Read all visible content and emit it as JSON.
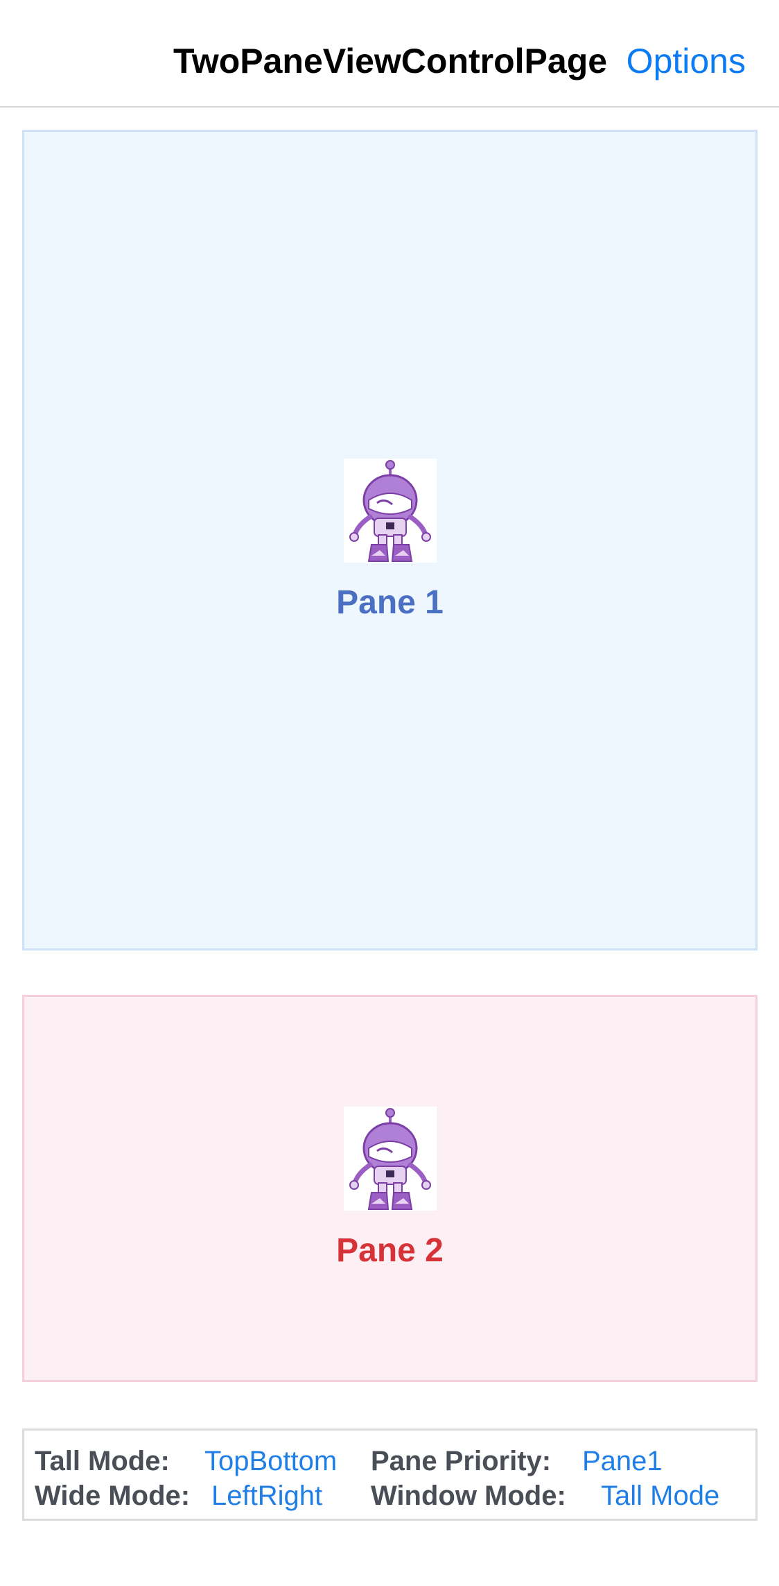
{
  "navbar": {
    "title": "TwoPaneViewControlPage",
    "options_label": "Options"
  },
  "panes": {
    "pane1": {
      "label": "Pane 1",
      "color": "#4a6fc3",
      "background": "#eef7fe"
    },
    "pane2": {
      "label": "Pane 2",
      "color": "#d63339",
      "background": "#fdf0f5"
    }
  },
  "info": {
    "tall_mode_label": "Tall Mode:",
    "tall_mode_value": "TopBottom",
    "pane_priority_label": "Pane Priority:",
    "pane_priority_value": "Pane1",
    "wide_mode_label": "Wide Mode:",
    "wide_mode_value": "LeftRight",
    "window_mode_label": "Window Mode:",
    "window_mode_value": "Tall Mode"
  },
  "colors": {
    "accent": "#0a7bf2",
    "robot": "#9b5fc4"
  },
  "icons": [
    "robot-mascot-icon"
  ]
}
